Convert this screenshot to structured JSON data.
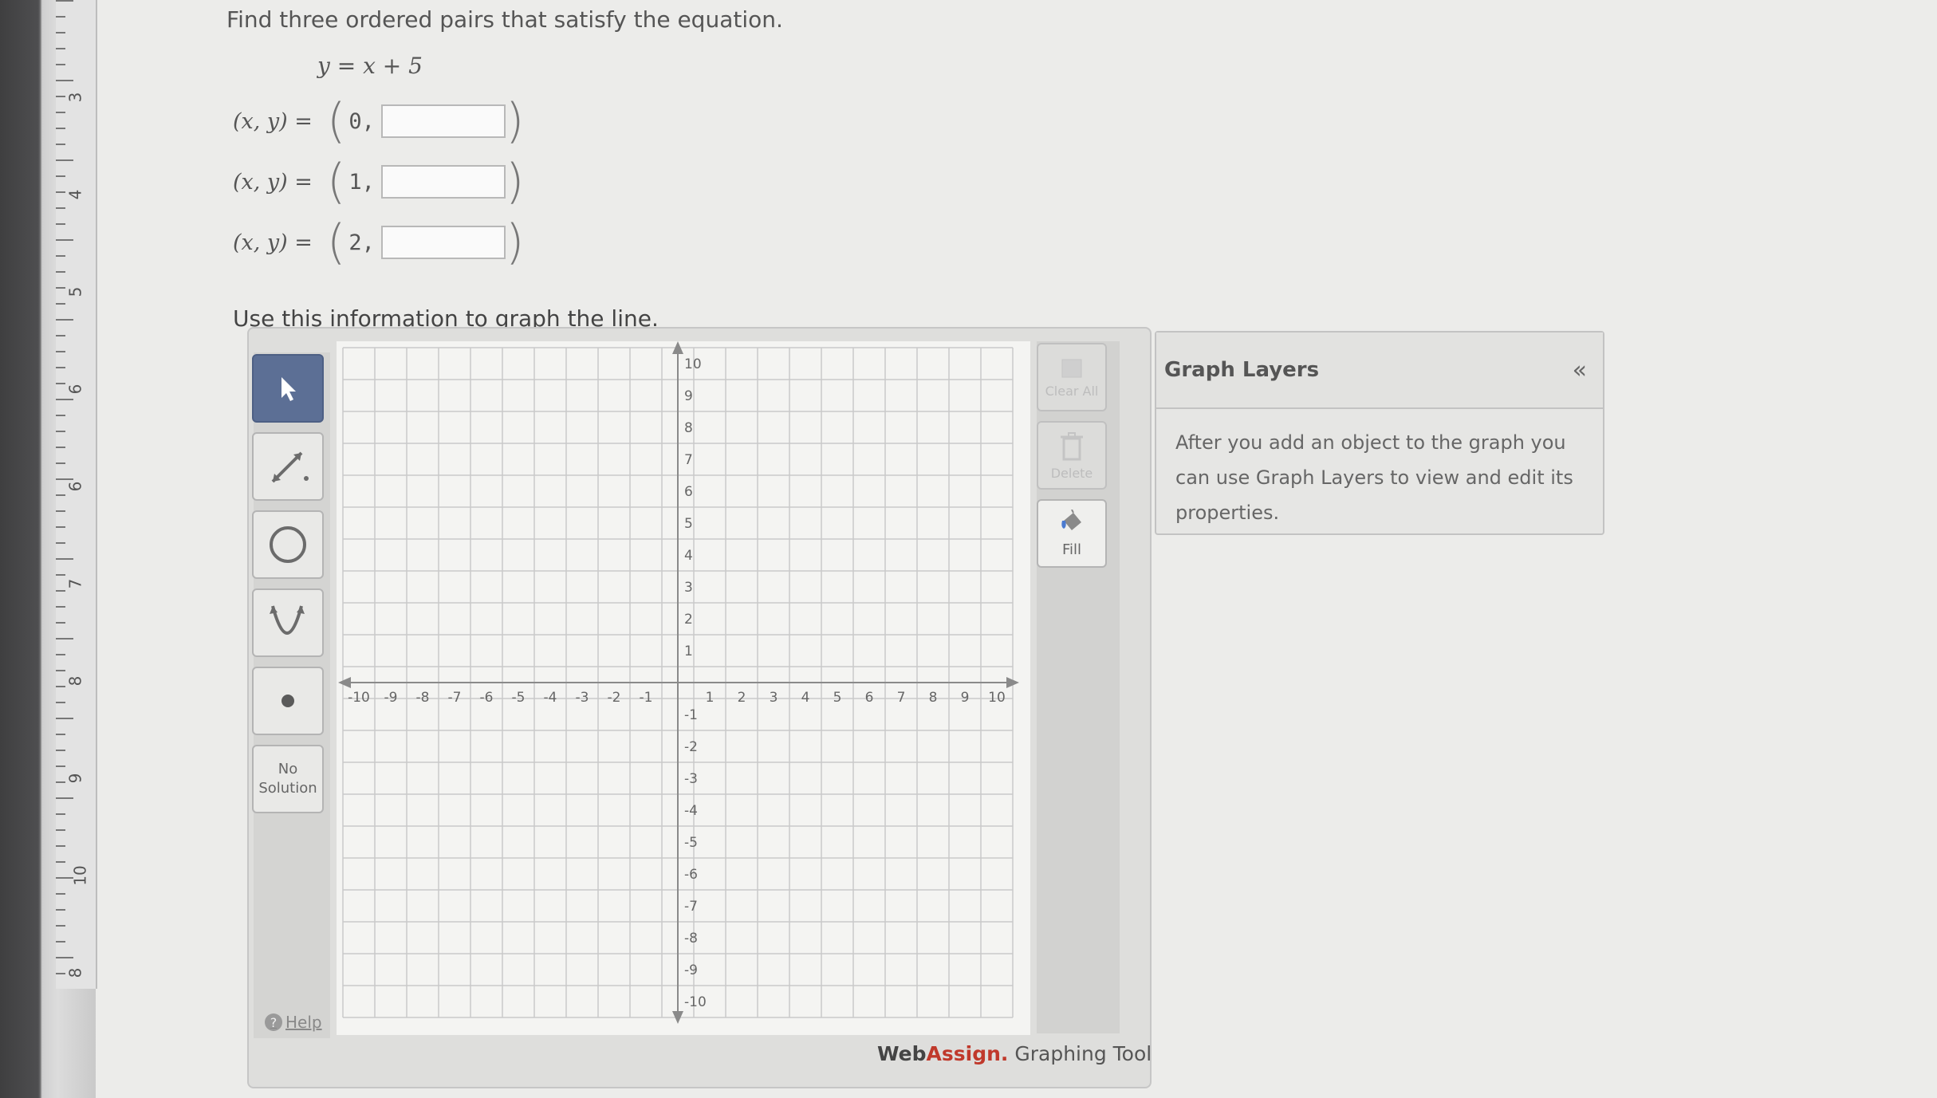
{
  "question": "Find three ordered pairs that satisfy the equation.",
  "equation": "y = x + 5",
  "pairs": [
    {
      "lhs": "(x, y) =",
      "x": "0,",
      "value": ""
    },
    {
      "lhs": "(x, y) =",
      "x": "1,",
      "value": ""
    },
    {
      "lhs": "(x, y) =",
      "x": "2,",
      "value": ""
    }
  ],
  "instruction": "Use this information to graph the line.",
  "tools": {
    "no_solution": "No Solution",
    "help": "Help"
  },
  "right_tools": {
    "clear_all": "Clear All",
    "delete": "Delete",
    "fill": "Fill"
  },
  "graph": {
    "x_ticks": [
      "-10",
      "-9",
      "-8",
      "-7",
      "-6",
      "-5",
      "-4",
      "-3",
      "-2",
      "-1",
      "1",
      "2",
      "3",
      "4",
      "5",
      "6",
      "7",
      "8",
      "9",
      "10"
    ],
    "y_ticks": [
      "10",
      "9",
      "8",
      "7",
      "6",
      "5",
      "4",
      "3",
      "2",
      "1",
      "-1",
      "-2",
      "-3",
      "-4",
      "-5",
      "-6",
      "-7",
      "-8",
      "-9",
      "-10"
    ]
  },
  "brand": {
    "web": "Web",
    "assign": "Assign.",
    "tool": " Graphing Tool"
  },
  "layers": {
    "title": "Graph Layers",
    "collapse": "«",
    "body": "After you add an object to the graph you can use Graph Layers to view and edit its properties."
  },
  "ruler": [
    "3",
    "4",
    "5",
    "6",
    "6",
    "7",
    "8",
    "9",
    "10",
    "8"
  ]
}
